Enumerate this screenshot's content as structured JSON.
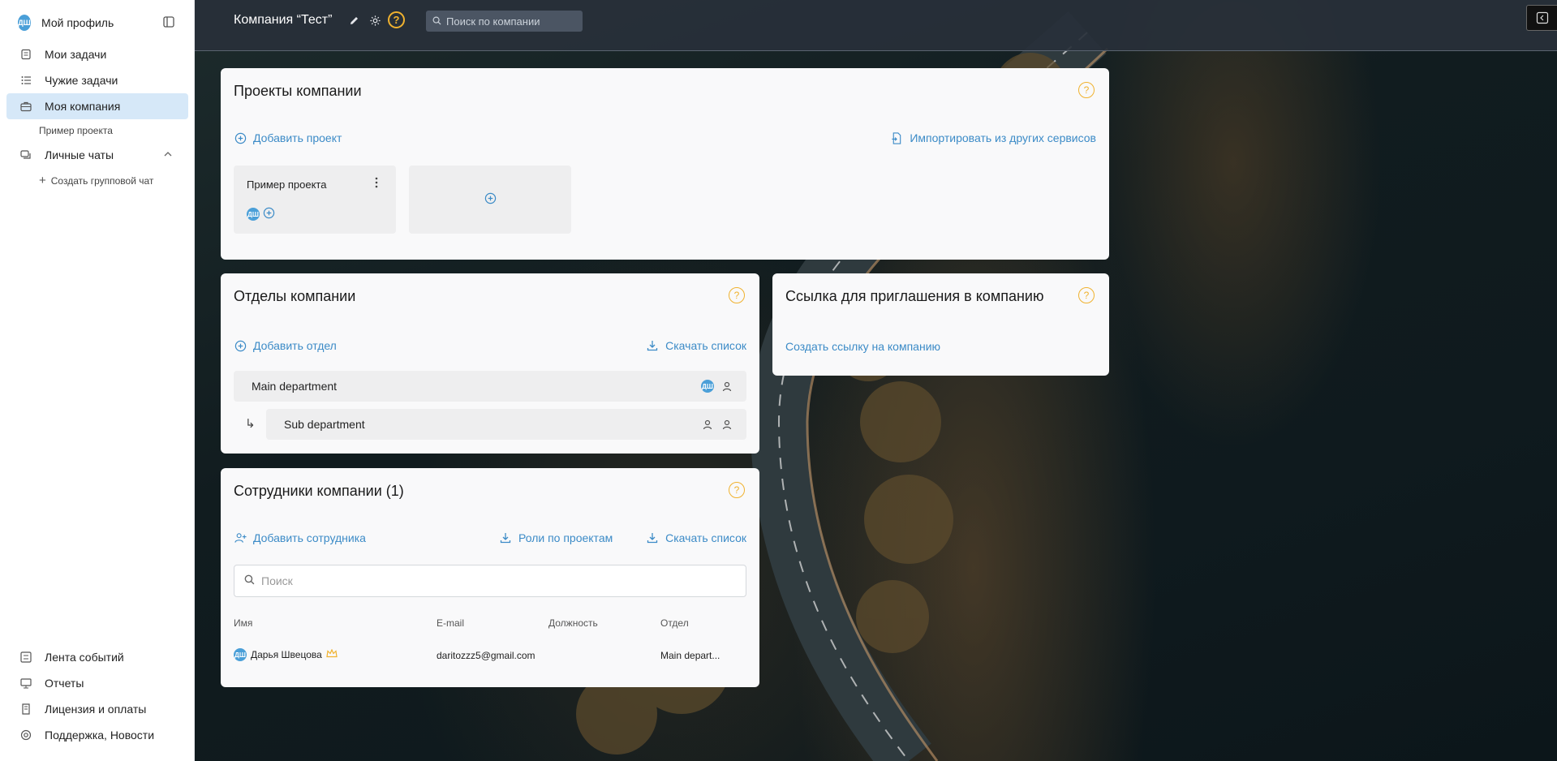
{
  "sidebar": {
    "profile_label": "Мой профиль",
    "avatar_initials": "ДШ",
    "nav": [
      {
        "label": "Мои задачи",
        "icon": "tasks-icon"
      },
      {
        "label": "Чужие задачи",
        "icon": "list-icon"
      },
      {
        "label": "Моя компания",
        "icon": "briefcase-icon"
      }
    ],
    "sub_project": "Пример проекта",
    "chats_label": "Личные чаты",
    "create_group_chat": "Создать групповой чат",
    "bottom": [
      {
        "label": "Лента событий"
      },
      {
        "label": "Отчеты"
      },
      {
        "label": "Лицензия и оплаты"
      },
      {
        "label": "Поддержка, Новости"
      }
    ]
  },
  "header": {
    "title": "Компания  “Тест”",
    "help": "?",
    "search_placeholder": "Поиск по компании"
  },
  "projects": {
    "title": "Проекты компании",
    "help": "?",
    "add_label": "Добавить проект",
    "import_label": "Импортировать из других сервисов",
    "project_name": "Пример проекта",
    "member_initials": "ДШ"
  },
  "departments": {
    "title": "Отделы компании",
    "help": "?",
    "add_label": "Добавить отдел",
    "download_label": "Скачать список",
    "main_department": "Main department",
    "main_avatar": "ДШ",
    "sub_department": "Sub department",
    "sub_arrow": "↳"
  },
  "invite": {
    "title": "Ссылка для приглашения в компанию",
    "help": "?",
    "create_link": "Создать ссылку на компанию"
  },
  "employees": {
    "title": "Сотрудники компании",
    "count": "(1)",
    "help": "?",
    "add_label": "Добавить сотрудника",
    "roles_label": "Роли по проектам",
    "download_label": "Скачать список",
    "search_placeholder": "Поиск",
    "columns": [
      "Имя",
      "E-mail",
      "Должность",
      "Отдел"
    ],
    "rows": [
      {
        "avatar": "ДШ",
        "name": "Дарья Швецова",
        "email": "daritozzz5@gmail.com",
        "position": "",
        "department": "Main depart..."
      }
    ]
  },
  "colors": {
    "accent": "#3c8bc7",
    "help": "#f0b22f",
    "active_nav": "#d6e8f8",
    "avatar": "#4a9fd8"
  }
}
